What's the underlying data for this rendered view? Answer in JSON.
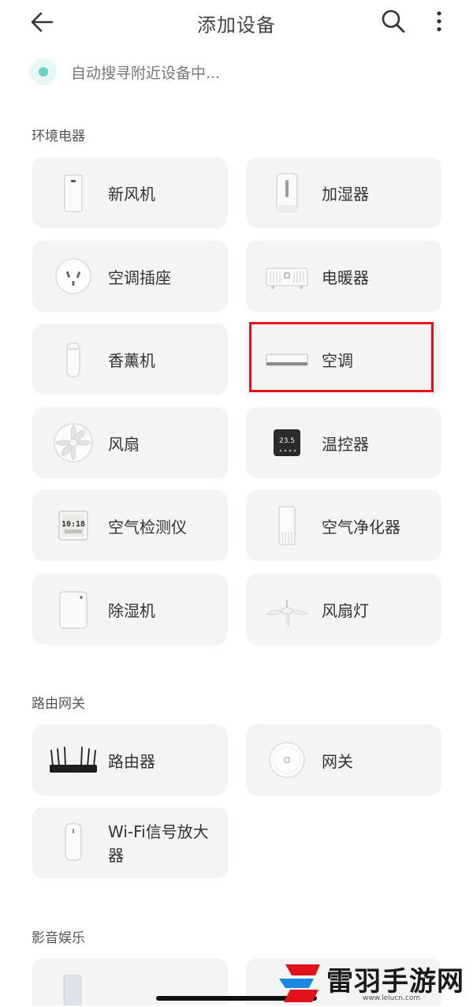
{
  "header": {
    "title": "添加设备"
  },
  "scan": {
    "text": "自动搜寻附近设备中..."
  },
  "sections": [
    {
      "title": "环境电器"
    },
    {
      "title": "路由网关"
    },
    {
      "title": "影音娱乐"
    }
  ],
  "devices": {
    "fresh_air": "新风机",
    "humidifier": "加湿器",
    "ac_socket": "空调插座",
    "heater": "电暖器",
    "aroma": "香薰机",
    "air_conditioner": "空调",
    "fan": "风扇",
    "thermostat": "温控器",
    "air_monitor": "空气检测仪",
    "air_purifier": "空气净化器",
    "dehumidifier": "除湿机",
    "fan_light": "风扇灯",
    "router": "路由器",
    "gateway": "网关",
    "wifi_extender": "Wi-Fi信号放大器"
  },
  "icons": {
    "thermostat_display": "23.5",
    "monitor_display": "10:18"
  },
  "watermark": {
    "text": "雷羽手游网",
    "url": "www.leiucn.com"
  },
  "colors": {
    "highlight": "#e3121a",
    "scan_accent": "#6cd2c6",
    "card_bg": "#f4f4f4"
  }
}
